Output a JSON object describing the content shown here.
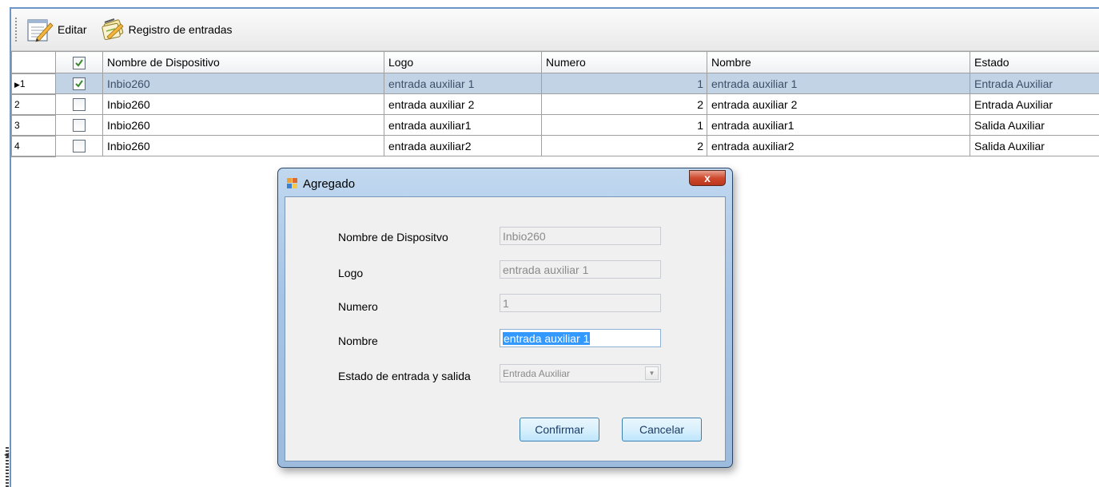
{
  "toolbar": {
    "edit_label": "Editar",
    "log_label": "Registro de entradas"
  },
  "grid": {
    "columns": [
      "Nombre de Dispositivo",
      "Logo",
      "Numero",
      "Nombre",
      "Estado"
    ],
    "header_checked": true,
    "rows": [
      {
        "index": "1",
        "current": true,
        "checked": true,
        "device": "Inbio260",
        "logo": "entrada auxiliar 1",
        "numero": "1",
        "nombre": "entrada auxiliar 1",
        "estado": "Entrada Auxiliar"
      },
      {
        "index": "2",
        "current": false,
        "checked": false,
        "device": "Inbio260",
        "logo": "entrada auxiliar 2",
        "numero": "2",
        "nombre": "entrada auxiliar 2",
        "estado": "Entrada Auxiliar"
      },
      {
        "index": "3",
        "current": false,
        "checked": false,
        "device": "Inbio260",
        "logo": "entrada auxiliar1",
        "numero": "1",
        "nombre": "entrada auxiliar1",
        "estado": "Salida Auxiliar"
      },
      {
        "index": "4",
        "current": false,
        "checked": false,
        "device": "Inbio260",
        "logo": "entrada auxiliar2",
        "numero": "2",
        "nombre": "entrada auxiliar2",
        "estado": "Salida Auxiliar"
      }
    ]
  },
  "dialog": {
    "title": "Agregado",
    "close_label": "x",
    "fields": {
      "device_label": "Nombre de Dispositvo",
      "device_value": "Inbio260",
      "logo_label": "Logo",
      "logo_value": "entrada auxiliar 1",
      "numero_label": "Numero",
      "numero_value": "1",
      "nombre_label": "Nombre",
      "nombre_value": "entrada auxiliar 1",
      "estado_label": "Estado de entrada y salida",
      "estado_value": "Entrada Auxiliar"
    },
    "confirm_label": "Confirmar",
    "cancel_label": "Cancelar"
  },
  "icons": {
    "edit": "edit-notepad-icon",
    "log": "register-entries-icon",
    "dialog": "app-window-icon",
    "current_row": "row-pointer-icon",
    "check": "checkmark-icon",
    "dropdown": "chevron-down-icon"
  },
  "colors": {
    "selected_row": "#c3d3e6",
    "dialog_frame": "#a7c5e6",
    "text_highlight": "#3399ff",
    "close_button": "#cf4a2e"
  }
}
